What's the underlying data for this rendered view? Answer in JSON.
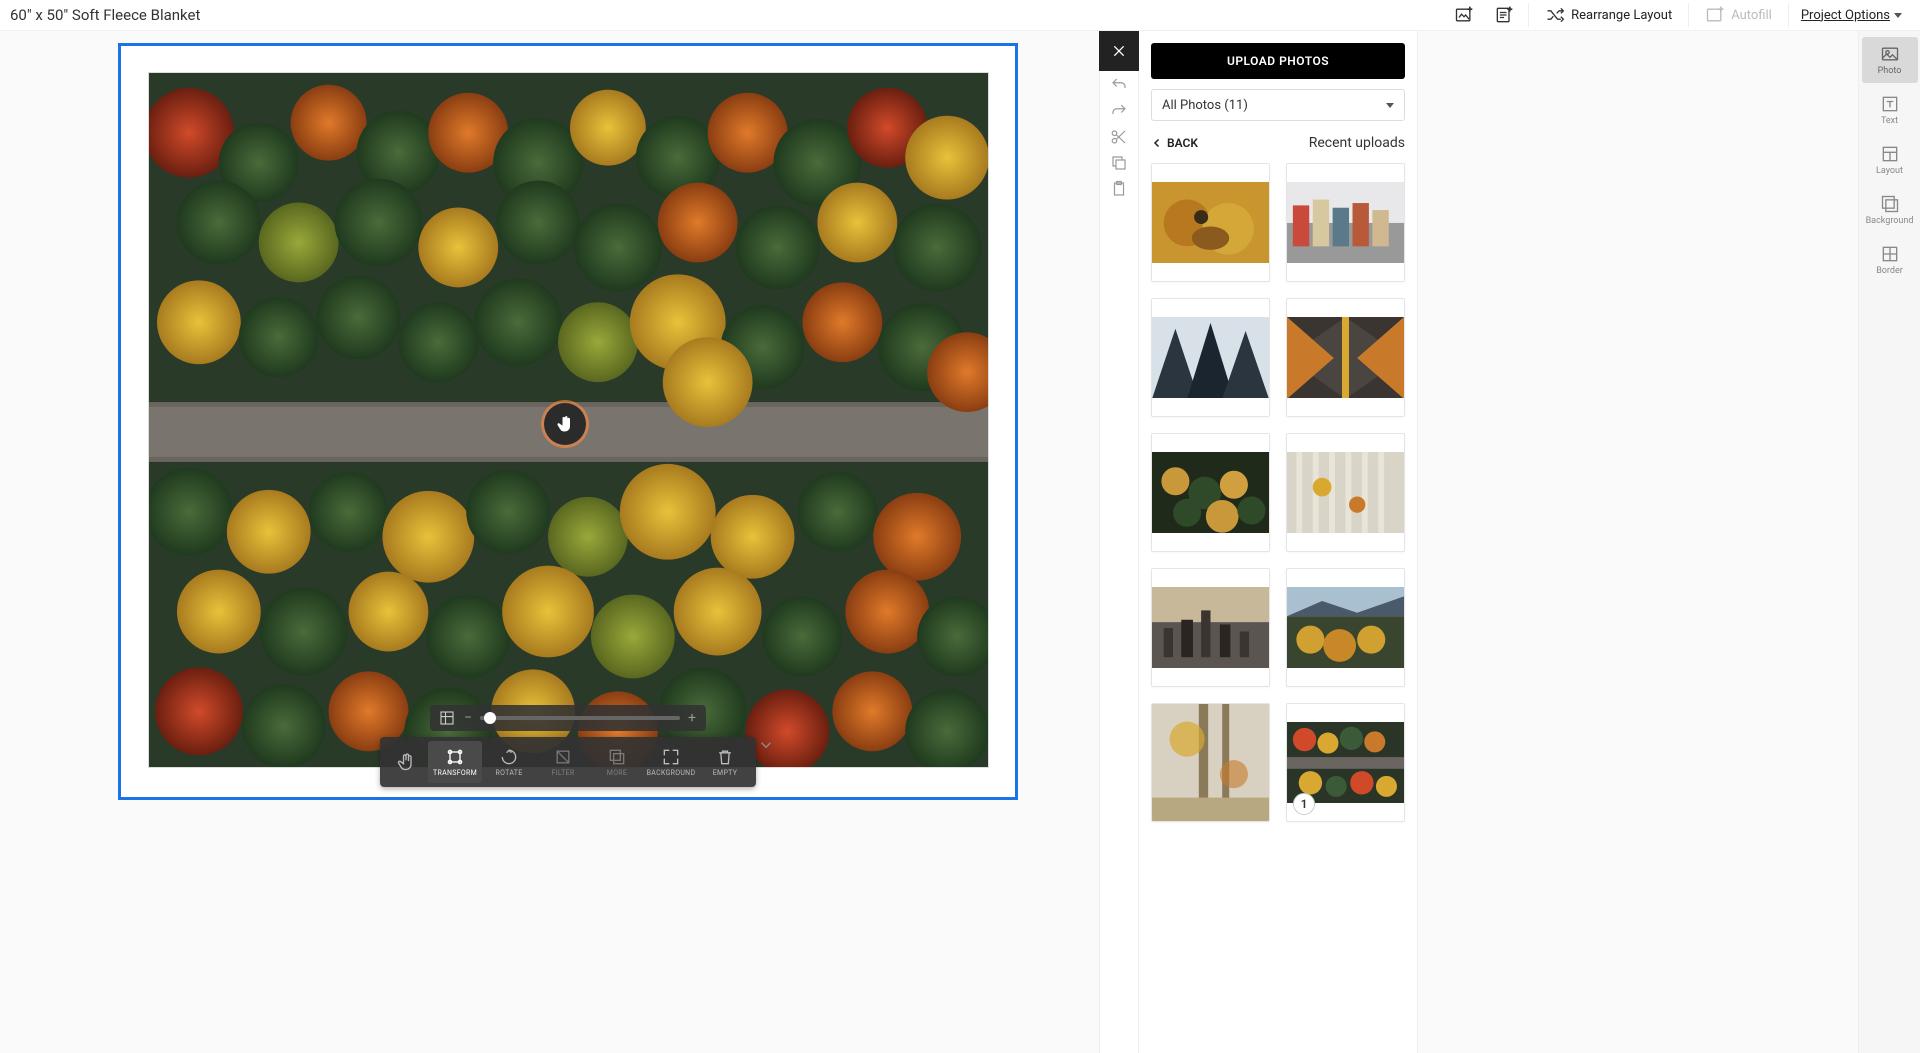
{
  "header": {
    "title": "60\" x 50\" Soft Fleece Blanket",
    "rearrange_label": "Rearrange Layout",
    "autofill_label": "Autofill",
    "project_options_label": "Project Options"
  },
  "panel": {
    "upload_label": "UPLOAD PHOTOS",
    "filter_label": "All Photos (11)",
    "back_label": "BACK",
    "section_title": "Recent uploads"
  },
  "rail": {
    "photo": "Photo",
    "text": "Text",
    "layout": "Layout",
    "background": "Background",
    "border": "Border"
  },
  "tools": {
    "transform": "TRANSFORM",
    "rotate": "ROTATE",
    "filter": "FILTER",
    "more": "MORE",
    "background": "BACKGROUND",
    "empty": "EMPTY"
  },
  "thumbs": {
    "badge_count": "1"
  },
  "zoom": {
    "minus": "−",
    "plus": "+"
  }
}
